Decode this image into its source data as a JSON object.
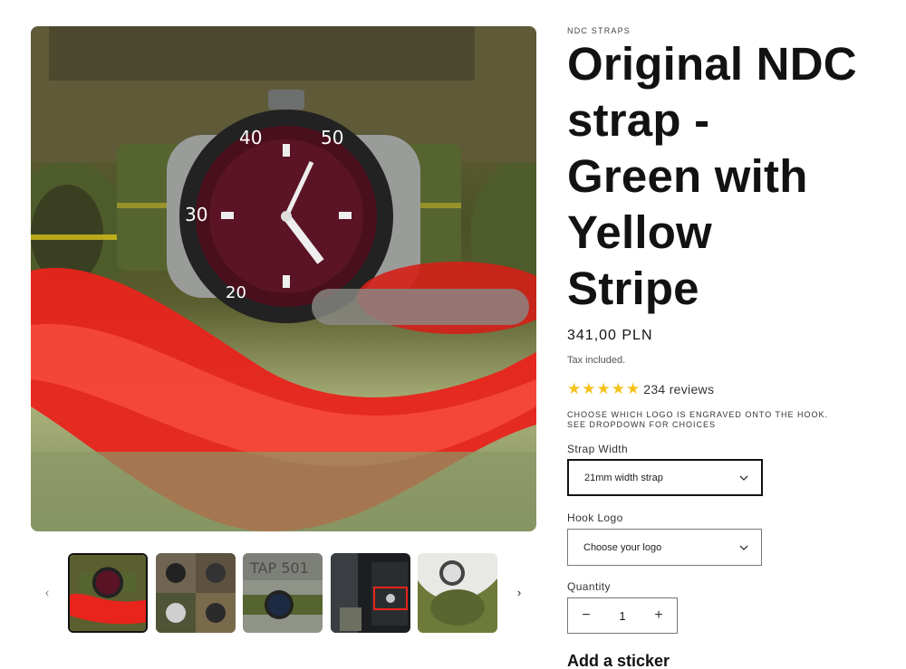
{
  "product": {
    "vendor": "NDC STRAPS",
    "title": "Original NDC strap - Green with Yellow Stripe",
    "price": "341,00 PLN",
    "tax_note": "Tax included.",
    "rating": {
      "stars": 5,
      "reviews_label": "234 reviews"
    },
    "logo_note": "CHOOSE WHICH LOGO IS ENGRAVED ONTO THE HOOK. SEE DROPDOWN FOR CHOICES"
  },
  "options": {
    "strap_width": {
      "label": "Strap Width",
      "selected": "21mm width strap"
    },
    "hook_logo": {
      "label": "Hook Logo",
      "selected": "Choose your logo"
    }
  },
  "quantity": {
    "label": "Quantity",
    "value": "1",
    "decrement": "−",
    "increment": "+"
  },
  "sticker_heading": "Add a sticker",
  "gallery": {
    "prev_arrow": "‹",
    "next_arrow": "›",
    "main_image_alt": "Tudor Pelagos watch on green strap with red carabiner",
    "thumbnails": 5,
    "active_thumbnail": 1
  },
  "colors": {
    "star": "#f5c21b",
    "text": "#121212",
    "strap_green": "#4e5b2a",
    "stripe_yellow": "#d8c11c",
    "hook_red": "#e8241c"
  }
}
